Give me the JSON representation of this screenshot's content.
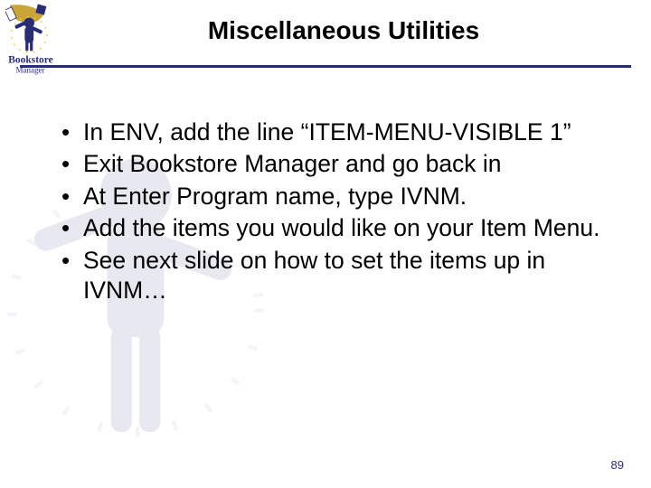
{
  "logo": {
    "line1": "Bookstore",
    "line2": "Manager"
  },
  "title": "Miscellaneous Utilities",
  "bullets": [
    "In ENV, add the line “ITEM-MENU-VISIBLE  1”",
    "Exit Bookstore Manager and go back in",
    "At Enter Program name, type IVNM.",
    "Add the items you would like on your Item Menu.",
    "See next slide on how to set the items up in IVNM…"
  ],
  "page_number": "89"
}
